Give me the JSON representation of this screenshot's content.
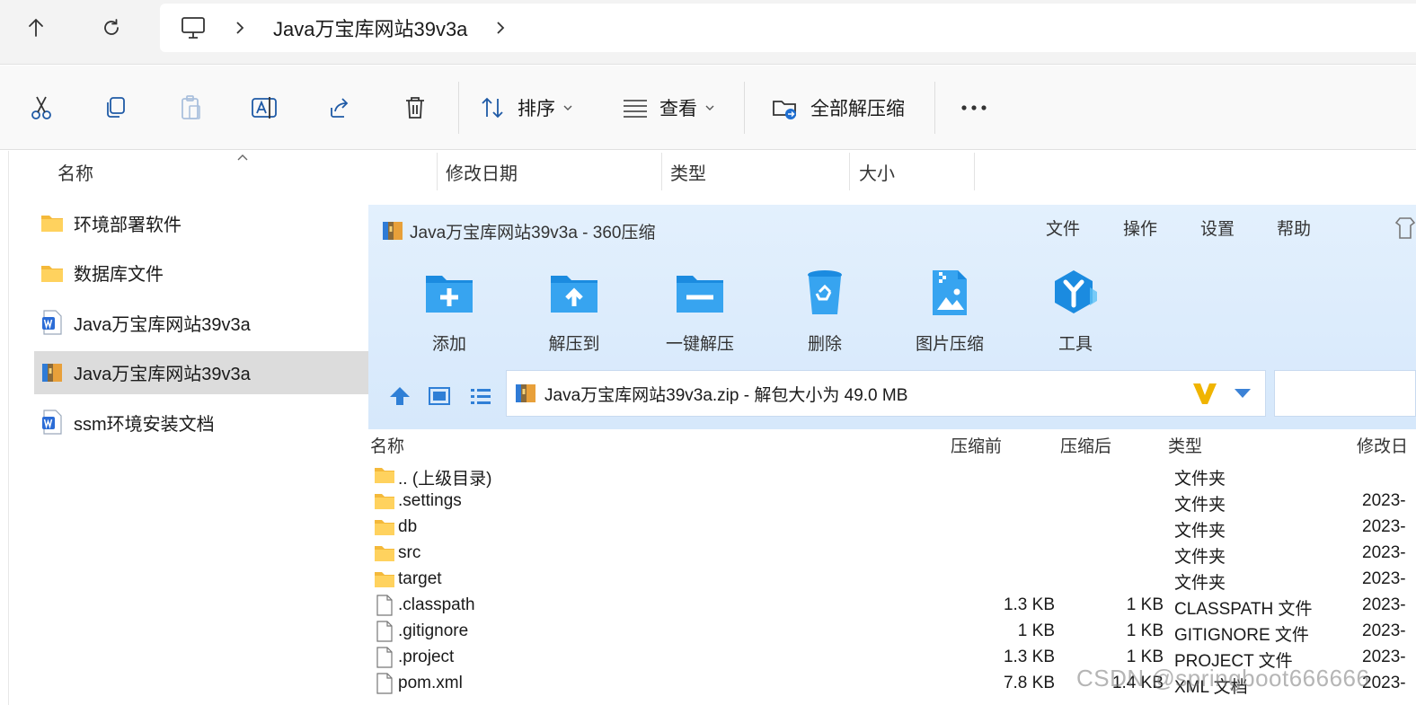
{
  "address": {
    "path_segment": "Java万宝库网站39v3a",
    "icons": [
      "up-arrow-icon",
      "refresh-icon",
      "monitor-icon",
      "chevron-right-icon"
    ]
  },
  "commands": {
    "sort_label": "排序",
    "view_label": "查看",
    "extract_all_label": "全部解压缩",
    "icons": [
      "scissors-icon",
      "copy-icon",
      "paste-icon",
      "rename-icon",
      "share-icon",
      "trash-icon",
      "more-icon"
    ]
  },
  "columns": {
    "name": "名称",
    "modified": "修改日期",
    "type": "类型",
    "size": "大小"
  },
  "files": [
    {
      "name": "环境部署软件",
      "icon": "folder-icon"
    },
    {
      "name": "数据库文件",
      "icon": "folder-icon"
    },
    {
      "name": "Java万宝库网站39v3a",
      "icon": "word-doc-icon"
    },
    {
      "name": "Java万宝库网站39v3a",
      "icon": "zip-archive-icon",
      "selected": true
    },
    {
      "name": "ssm环境安装文档",
      "icon": "word-doc-icon"
    }
  ],
  "zip_window": {
    "title": "Java万宝库网站39v3a - 360压缩",
    "menu": [
      "文件",
      "操作",
      "设置",
      "帮助"
    ],
    "toolbar": [
      {
        "label": "添加",
        "icon": "add-folder-icon"
      },
      {
        "label": "解压到",
        "icon": "extract-to-icon"
      },
      {
        "label": "一键解压",
        "icon": "one-click-extract-icon"
      },
      {
        "label": "删除",
        "icon": "recycle-icon"
      },
      {
        "label": "图片压缩",
        "icon": "image-compress-icon"
      },
      {
        "label": "工具",
        "icon": "tools-icon"
      }
    ],
    "path_text": "Java万宝库网站39v3a.zip - 解包大小为 49.0 MB",
    "columns": {
      "name": "名称",
      "before": "压缩前",
      "after": "压缩后",
      "type": "类型",
      "date": "修改日"
    },
    "rows": [
      {
        "name": ".. (上级目录)",
        "before": "",
        "after": "",
        "type": "文件夹",
        "date": "",
        "icon": "folder-icon"
      },
      {
        "name": ".settings",
        "before": "",
        "after": "",
        "type": "文件夹",
        "date": "2023-",
        "icon": "folder-icon"
      },
      {
        "name": "db",
        "before": "",
        "after": "",
        "type": "文件夹",
        "date": "2023-",
        "icon": "folder-icon"
      },
      {
        "name": "src",
        "before": "",
        "after": "",
        "type": "文件夹",
        "date": "2023-",
        "icon": "folder-icon"
      },
      {
        "name": "target",
        "before": "",
        "after": "",
        "type": "文件夹",
        "date": "2023-",
        "icon": "folder-icon"
      },
      {
        "name": ".classpath",
        "before": "1.3 KB",
        "after": "1 KB",
        "type": "CLASSPATH 文件",
        "date": "2023-",
        "icon": "file-icon"
      },
      {
        "name": ".gitignore",
        "before": "1 KB",
        "after": "1 KB",
        "type": "GITIGNORE 文件",
        "date": "2023-",
        "icon": "file-icon"
      },
      {
        "name": ".project",
        "before": "1.3 KB",
        "after": "1 KB",
        "type": "PROJECT 文件",
        "date": "2023-",
        "icon": "file-icon"
      },
      {
        "name": "pom.xml",
        "before": "7.8 KB",
        "after": "1.4 KB",
        "type": "XML 文档",
        "date": "2023-",
        "icon": "file-icon"
      }
    ]
  },
  "watermark": "CSDN @springboot666666"
}
